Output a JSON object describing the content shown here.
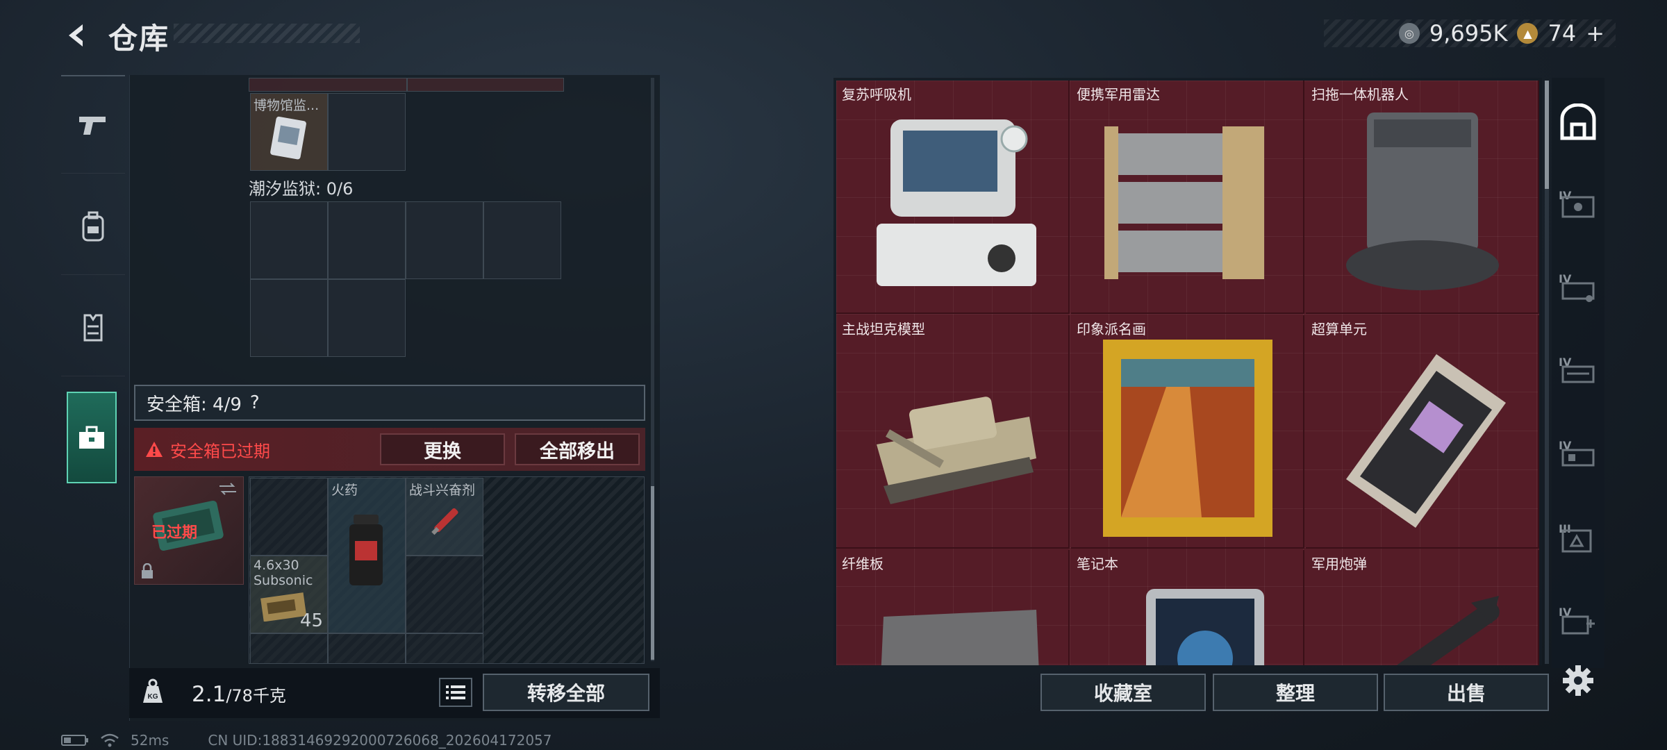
{
  "header": {
    "title": "仓库",
    "currency": [
      {
        "icon": "silver-coin-icon",
        "value": "9,695K",
        "color": "#c9ced2"
      },
      {
        "icon": "gold-coin-icon",
        "value": "74",
        "plus": "+",
        "color": "#d8a542"
      }
    ]
  },
  "sidebar": {
    "tabs": [
      {
        "icon": "pistol-icon"
      },
      {
        "icon": "backpack-icon"
      },
      {
        "icon": "vest-icon"
      },
      {
        "icon": "toolbox-icon",
        "active": true
      }
    ]
  },
  "inventory": {
    "museum_item": {
      "label": "博物馆监..."
    },
    "tide_prison": "潮汐监狱: 0/6",
    "safebox": {
      "label": "安全箱: 4/9",
      "help": "?"
    },
    "expired": {
      "message": "安全箱已过期",
      "replace_label": "更换",
      "remove_all_label": "全部移出"
    },
    "safebox_tile": {
      "status": "已过期"
    },
    "items": [
      {
        "label": "火药"
      },
      {
        "label": "战斗兴奋剂"
      },
      {
        "label": "4.6x30 Subsonic",
        "count": "45"
      }
    ]
  },
  "footer": {
    "weight_current": "2.1",
    "weight_max": "/78千克",
    "weight_icon_text": "KG",
    "transfer_all_label": "转移全部"
  },
  "status_bar": {
    "ping": "52ms",
    "uid": "CN UID:18831469292000726068_202604172057"
  },
  "collection": {
    "items": [
      {
        "label": "复苏呼吸机"
      },
      {
        "label": "便携军用雷达"
      },
      {
        "label": "扫拖一体机器人"
      },
      {
        "label": "主战坦克模型"
      },
      {
        "label": "印象派名画"
      },
      {
        "label": "超算单元"
      },
      {
        "label": "纤维板"
      },
      {
        "label": "笔记本"
      },
      {
        "label": "军用炮弹"
      }
    ],
    "buttons": {
      "collection_room": "收藏室",
      "organize": "整理",
      "sell": "出售"
    }
  },
  "right_sidebar": {
    "tiers": [
      "IV",
      "IV",
      "IV",
      "IV",
      "III",
      "IV"
    ]
  }
}
